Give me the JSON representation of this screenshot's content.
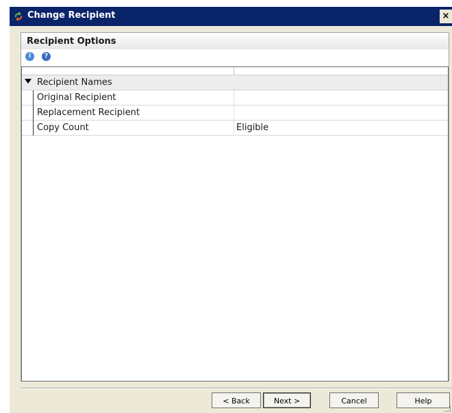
{
  "window": {
    "title": "Change Recipient",
    "close_label": "×"
  },
  "panel": {
    "title": "Recipient Options"
  },
  "tools": {
    "info_icon": "info-icon",
    "help_icon": "help-icon",
    "info_glyph": "i",
    "help_glyph": "?"
  },
  "grid": {
    "group": {
      "label": "Recipient Names",
      "expanded": true
    },
    "rows": [
      {
        "name": "Original Recipient",
        "value": ""
      },
      {
        "name": "Replacement Recipient",
        "value": ""
      },
      {
        "name": "Copy Count",
        "value": "Eligible"
      }
    ]
  },
  "buttons": {
    "back": "< Back",
    "next": "Next >",
    "cancel": "Cancel",
    "help": "Help"
  }
}
